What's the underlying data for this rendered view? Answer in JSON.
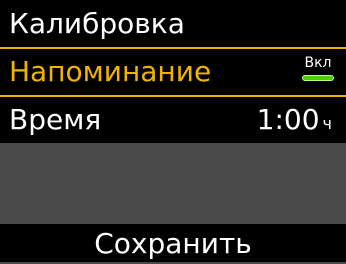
{
  "screen": {
    "title": "Калибровка"
  },
  "reminder": {
    "label": "Напоминание",
    "toggle_state": "Вкл",
    "toggle_on": true,
    "highlight_color": "#f0b400",
    "toggle_color": "#48d000"
  },
  "time": {
    "label": "Время",
    "value": "1:00",
    "unit": "ч"
  },
  "actions": {
    "save_label": "Сохранить"
  }
}
